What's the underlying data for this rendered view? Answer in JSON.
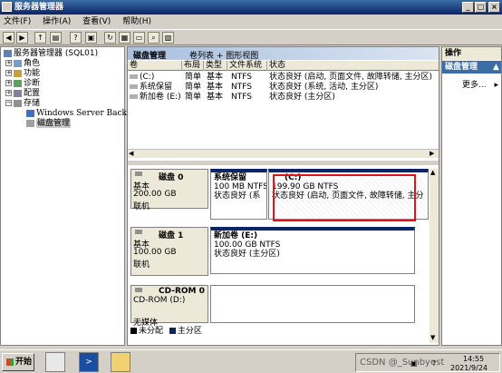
{
  "window": {
    "title": "服务器管理器",
    "min": "_",
    "max": "□",
    "close": "×"
  },
  "menu": [
    "文件(F)",
    "操作(A)",
    "查看(V)",
    "帮助(H)"
  ],
  "tree": [
    {
      "label": "服务器管理器 (SQL01)",
      "toggle": ""
    },
    {
      "label": "角色",
      "toggle": "+"
    },
    {
      "label": "功能",
      "toggle": "+"
    },
    {
      "label": "诊断",
      "toggle": "+"
    },
    {
      "label": "配置",
      "toggle": "+"
    },
    {
      "label": "存储",
      "toggle": "−"
    },
    {
      "label": "Windows Server Backup",
      "toggle": ""
    },
    {
      "label": "磁盘管理",
      "toggle": ""
    }
  ],
  "center": {
    "title": "磁盘管理",
    "view": "卷列表 + 图形视图",
    "columns": [
      "卷",
      "布局",
      "类型",
      "文件系统",
      "状态"
    ],
    "volumes": [
      {
        "vol": "(C:)",
        "layout": "简单",
        "type": "基本",
        "fs": "NTFS",
        "status": "状态良好 (启动, 页面文件, 故障转储, 主分区)"
      },
      {
        "vol": "系统保留",
        "layout": "简单",
        "type": "基本",
        "fs": "NTFS",
        "status": "状态良好 (系统, 活动, 主分区)"
      },
      {
        "vol": "新加卷 (E:)",
        "layout": "简单",
        "type": "基本",
        "fs": "NTFS",
        "status": "状态良好 (主分区)"
      }
    ],
    "disks": [
      {
        "name": "磁盘 0",
        "type": "基本",
        "size": "200.00 GB",
        "state": "联机",
        "parts": [
          {
            "name": "系统保留",
            "size": "100 MB NTFS",
            "status": "状态良好 (系"
          },
          {
            "name": "(C:)",
            "size": "199.90 GB NTFS",
            "status": "状态良好 (启动, 页面文件, 故障转储, 主分"
          }
        ]
      },
      {
        "name": "磁盘 1",
        "type": "基本",
        "size": "100.00 GB",
        "state": "联机",
        "parts": [
          {
            "name": "新加卷  (E:)",
            "size": "100.00 GB NTFS",
            "status": "状态良好 (主分区)"
          }
        ]
      },
      {
        "name": "CD-ROM 0",
        "type": "CD-ROM (D:)",
        "size": "",
        "state": "无媒体",
        "parts": []
      }
    ],
    "legend": [
      {
        "label": "未分配",
        "color": "#000000"
      },
      {
        "label": "主分区",
        "color": "#0a246a"
      }
    ]
  },
  "actions": {
    "header": "操作",
    "section": "磁盘管理",
    "more": "更多..."
  },
  "taskbar": {
    "start": "开始",
    "watermark": "CSDN @_Sunbyest",
    "time": "14:55",
    "date": "2021/9/24"
  }
}
